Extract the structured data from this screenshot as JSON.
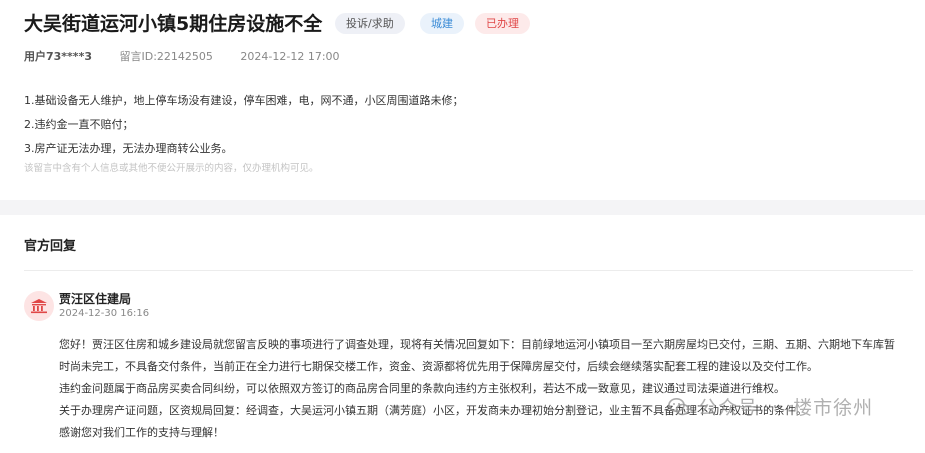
{
  "message": {
    "title": "大吴街道运河小镇5期住房设施不全",
    "tags": {
      "type": "投诉/求助",
      "category": "城建",
      "status": "已办理"
    },
    "user": "用户73****3",
    "id_label": "留言ID:22142505",
    "time": "2024-12-12 17:00",
    "lines": [
      "1.基础设备无人维护，地上停车场没有建设，停车困难，电，网不通，小区周围道路未修；",
      "2.违约金一直不赔付；",
      "3.房产证无法办理，无法办理商转公业务。"
    ],
    "notice": "该留言中含有个人信息或其他不便公开展示的内容，仅办理机构可见。"
  },
  "reply": {
    "heading": "官方回复",
    "org": "贾汪区住建局",
    "time": "2024-12-30 16:16",
    "lines": [
      "您好！贾汪区住房和城乡建设局就您留言反映的事项进行了调查处理，现将有关情况回复如下：目前绿地运河小镇项目一至六期房屋均已交付，三期、五期、六期地下车库暂",
      "时尚未完工，不具备交付条件，当前正在全力进行七期保交楼工作，资金、资源都将优先用于保障房屋交付，后续会继续落实配套工程的建设以及交付工作。",
      "违约金问题属于商品房买卖合同纠纷，可以依照双方签订的商品房合同里的条款向违约方主张权利，若达不成一致意见，建议通过司法渠道进行维权。",
      "关于办理房产证问题，区资规局回复：经调查，大吴运河小镇五期（满芳庭）小区，开发商未办理初始分割登记，业主暂不具备办理不动产权证书的条件。",
      " 感谢您对我们工作的支持与理解！"
    ]
  },
  "watermark": {
    "left": "公众号",
    "sep": "·",
    "right": "楼市徐州"
  },
  "colors": {
    "accent_red": "#e04848",
    "accent_blue": "#3a8bd6"
  },
  "icons": {
    "org": "government-building-icon",
    "watermark": "wechat-icon"
  }
}
